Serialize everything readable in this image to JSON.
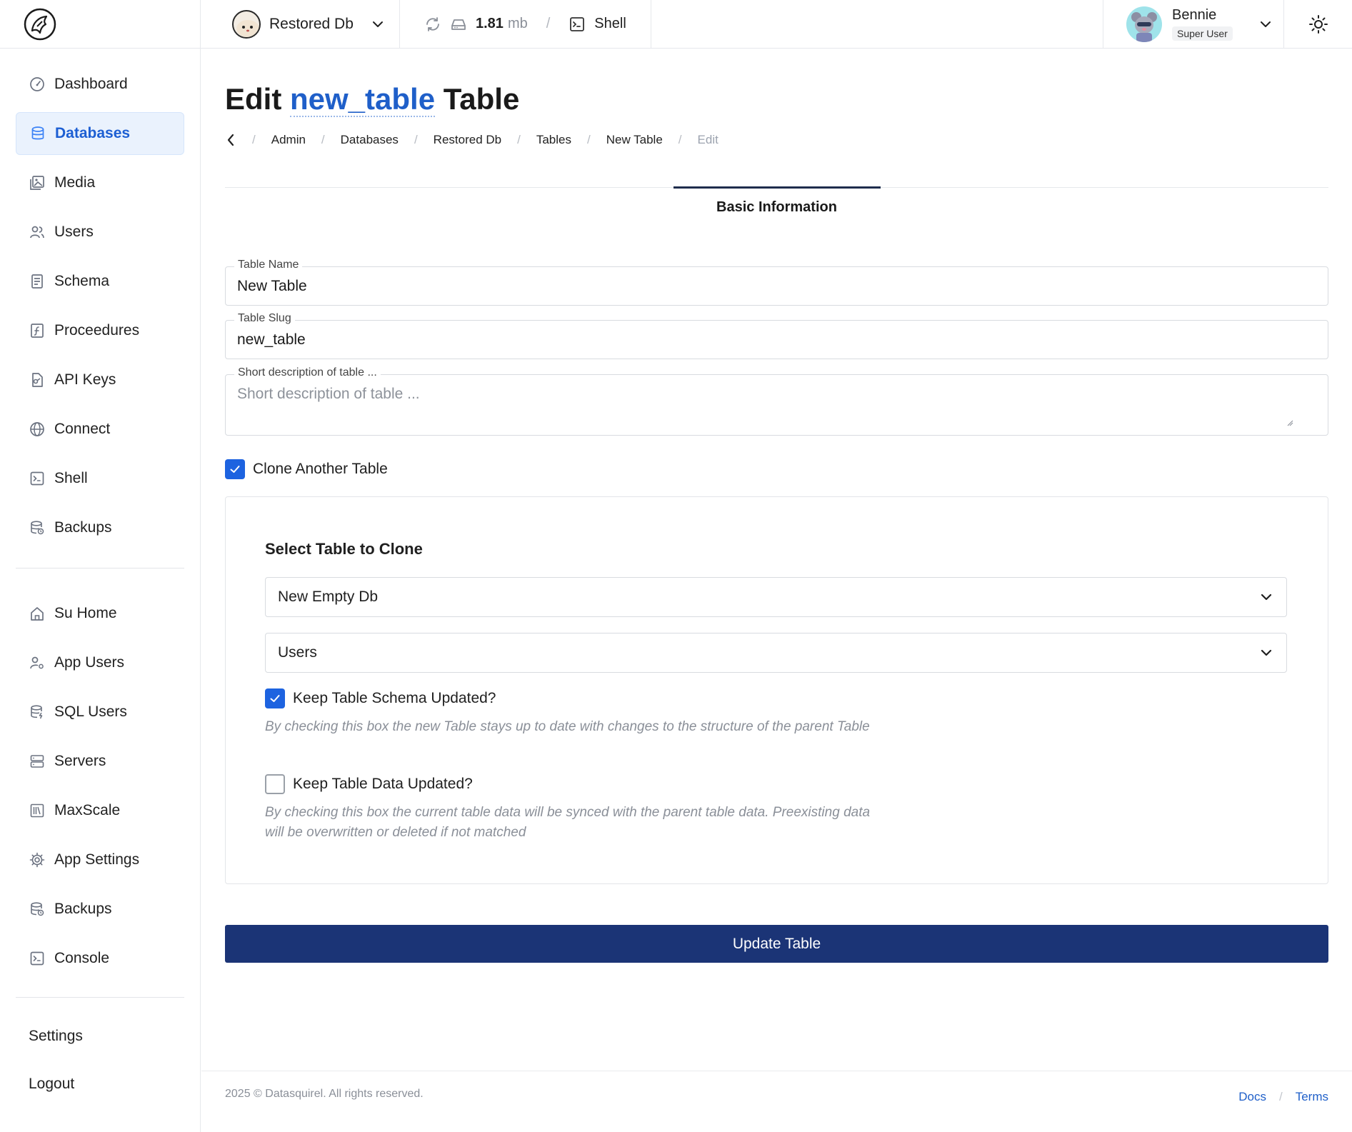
{
  "topbar": {
    "db_name": "Restored Db",
    "size_value": "1.81",
    "size_unit": "mb",
    "shell_label": "Shell",
    "user_name": "Bennie",
    "user_role": "Super User"
  },
  "sidebar": {
    "items": [
      {
        "label": "Dashboard",
        "icon": "dashboard-icon"
      },
      {
        "label": "Databases",
        "icon": "database-icon",
        "active": true
      },
      {
        "label": "Media",
        "icon": "media-icon"
      },
      {
        "label": "Users",
        "icon": "users-icon"
      },
      {
        "label": "Schema",
        "icon": "schema-icon"
      },
      {
        "label": "Proceedures",
        "icon": "function-icon"
      },
      {
        "label": "API Keys",
        "icon": "key-file-icon"
      },
      {
        "label": "Connect",
        "icon": "globe-icon"
      },
      {
        "label": "Shell",
        "icon": "terminal-icon"
      },
      {
        "label": "Backups",
        "icon": "backup-icon"
      }
    ],
    "admin_items": [
      {
        "label": "Su Home",
        "icon": "home-icon"
      },
      {
        "label": "App Users",
        "icon": "user-gear-icon"
      },
      {
        "label": "SQL Users",
        "icon": "database-bolt-icon"
      },
      {
        "label": "Servers",
        "icon": "server-icon"
      },
      {
        "label": "MaxScale",
        "icon": "library-icon"
      },
      {
        "label": "App Settings",
        "icon": "gear-icon"
      },
      {
        "label": "Backups",
        "icon": "backup-icon"
      },
      {
        "label": "Console",
        "icon": "terminal-icon"
      }
    ],
    "settings_label": "Settings",
    "logout_label": "Logout"
  },
  "page": {
    "title_prefix": "Edit",
    "title_highlight": "new_table",
    "title_suffix": "Table",
    "breadcrumb": [
      "Admin",
      "Databases",
      "Restored Db",
      "Tables",
      "New Table"
    ],
    "breadcrumb_current": "Edit",
    "tab_label": "Basic Information"
  },
  "form": {
    "table_name_label": "Table Name",
    "table_name_value": "New Table",
    "table_slug_label": "Table Slug",
    "table_slug_value": "new_table",
    "description_label": "Short description of table ...",
    "description_placeholder": "Short description of table ...",
    "clone_label": "Clone Another Table",
    "clone_checked": true,
    "clone_heading": "Select Table to Clone",
    "clone_db_value": "New Empty Db",
    "clone_table_value": "Users",
    "keep_schema_label": "Keep Table Schema Updated?",
    "keep_schema_checked": true,
    "keep_schema_help": "By checking this box the new Table stays up to date with changes to the structure of the parent Table",
    "keep_data_label": "Keep Table Data Updated?",
    "keep_data_checked": false,
    "keep_data_help": "By checking this box the current table data will be synced with the parent table data. Preexisting data will be overwritten or deleted if not matched",
    "submit_label": "Update Table"
  },
  "footer": {
    "copyright": "2025 © Datasquirel. All rights reserved.",
    "docs_label": "Docs",
    "terms_label": "Terms"
  },
  "colors": {
    "accent": "#1d63e0",
    "primary_button": "#1b3476",
    "active_nav_bg": "#eaf2fd",
    "link": "#1f5fc9"
  }
}
